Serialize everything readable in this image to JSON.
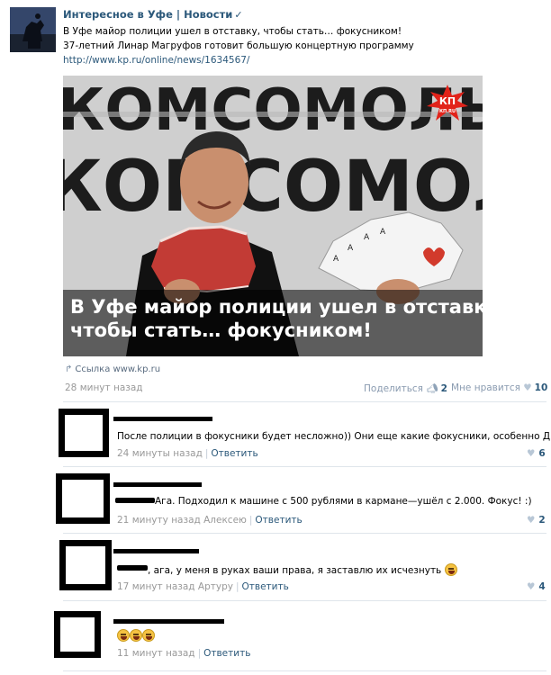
{
  "post": {
    "group_name": "Интересное в Уфе | Новости",
    "verified_mark": "✓",
    "text_line1": "В Уфе майор полиции ушел в отставку, чтобы стать… фокусником!",
    "text_line2": "37-летний Линар Магруфов готовит большую концертную программу",
    "link": "http://www.kp.ru/online/news/1634567/",
    "photo_caption_line1": "В Уфе майор полиции ушел в отставку,",
    "photo_caption_line2": "чтобы стать… фокусником!",
    "photo_logo": "КП",
    "photo_logo_sub": "КП.RU",
    "photo_bg_text": "КОМСОМОЛЬСКАЯ ПРАВДА",
    "source_label": "Ссылка www.kp.ru",
    "time": "28 минут назад",
    "share_label": "Поделиться",
    "share_count": "2",
    "like_label": "Мне нравится",
    "like_count": "10"
  },
  "comments": [
    {
      "text": "После полиции в фокусники будет несложно)) Они еще какие фокусники, особенно ДПС.",
      "time": "24 минуты назад",
      "reply_label": "Ответить",
      "likes": "6"
    },
    {
      "text": "Ага. Подходил к машине с 500 рублями в кармане—ушёл с 2.000. Фокус! :)",
      "time": "21 минуту назад Алексею",
      "reply_label": "Ответить",
      "likes": "2"
    },
    {
      "text": ", ага, у меня в руках ваши права, я заставлю их исчезнуть",
      "time": "17 минут назад Артуру",
      "reply_label": "Ответить",
      "likes": "4"
    },
    {
      "text": "",
      "time": "11 минут назад",
      "reply_label": "Ответить",
      "likes": ""
    }
  ],
  "colors": {
    "link": "#2b587a",
    "muted": "#999999",
    "divider": "#dfe5eb",
    "kp_red": "#e2231a"
  },
  "icons": {
    "share": "megaphone-icon",
    "like": "heart-icon",
    "source": "share-arrow-icon",
    "emoji": "laughing-emoji-icon"
  }
}
